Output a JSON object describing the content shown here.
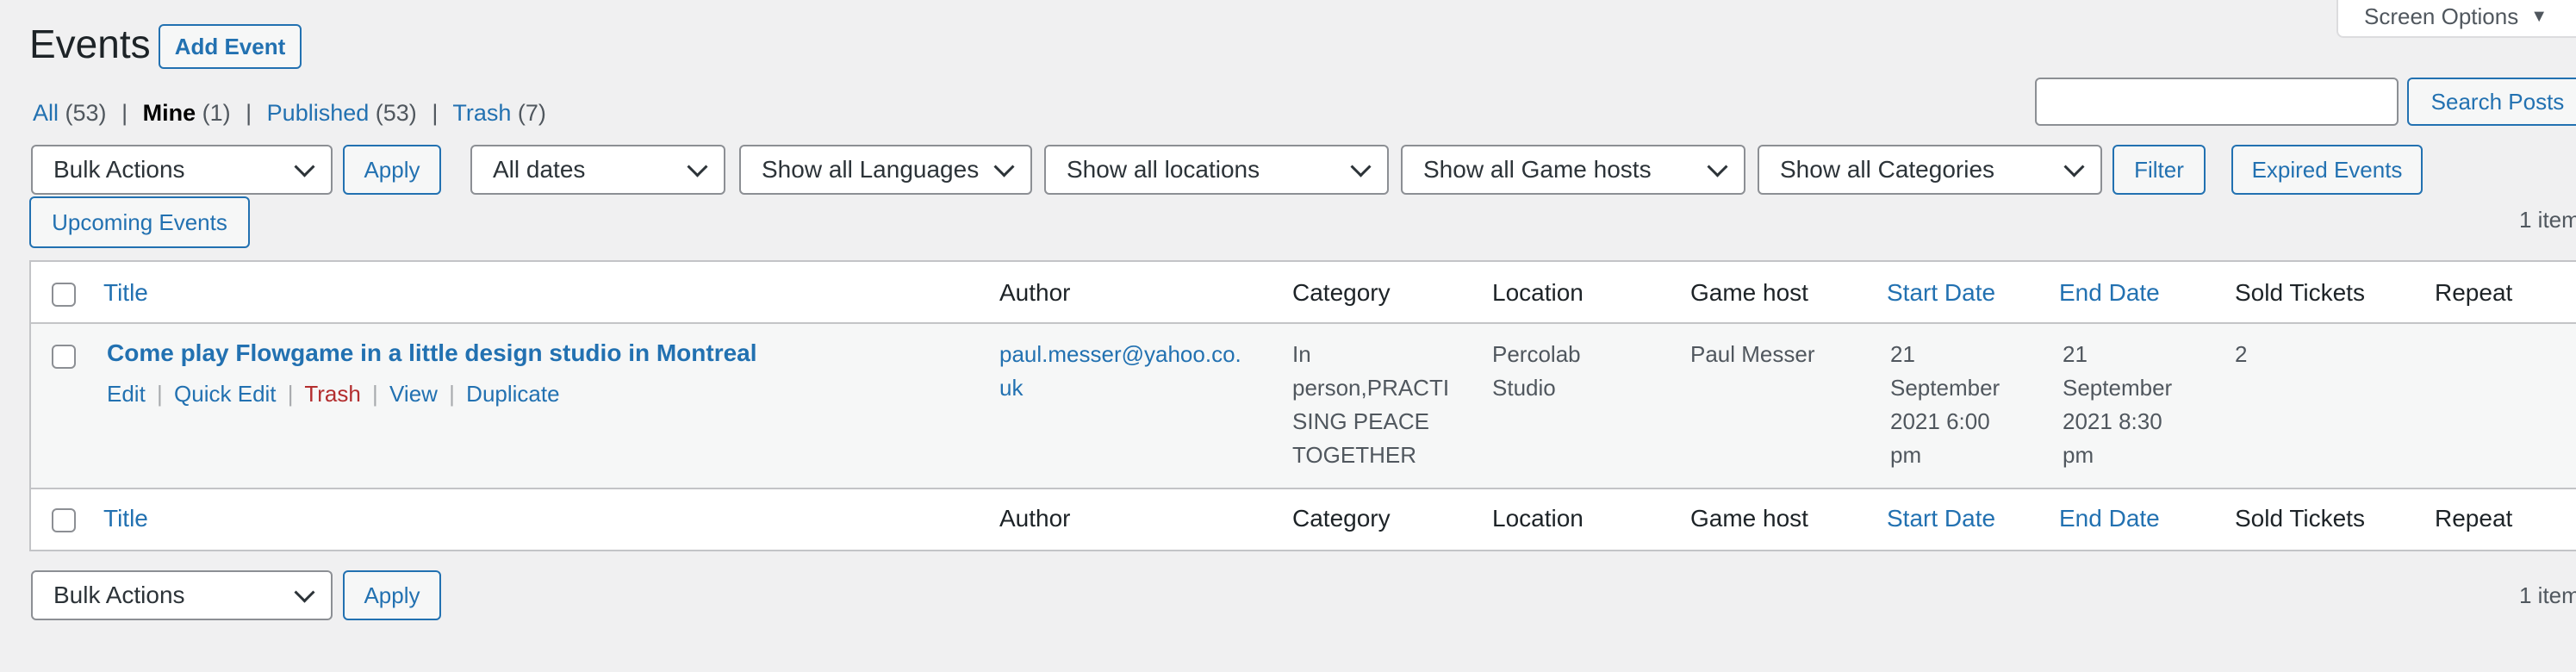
{
  "page": {
    "title": "Events",
    "add_button": "Add Event",
    "screen_options": "Screen Options"
  },
  "filters_nav": {
    "all_label": "All",
    "all_count": "(53)",
    "mine_label": "Mine",
    "mine_count": "(1)",
    "published_label": "Published",
    "published_count": "(53)",
    "trash_label": "Trash",
    "trash_count": "(7)",
    "sep": "|"
  },
  "search": {
    "button": "Search Posts",
    "value": ""
  },
  "toolbar": {
    "bulk_actions": "Bulk Actions",
    "apply": "Apply",
    "dates": "All dates",
    "languages": "Show all Languages",
    "locations": "Show all locations",
    "hosts": "Show all Game hosts",
    "categories": "Show all Categories",
    "filter": "Filter",
    "expired": "Expired Events",
    "upcoming": "Upcoming Events",
    "items_count": "1 item"
  },
  "table": {
    "columns": [
      "Title",
      "Author",
      "Category",
      "Location",
      "Game host",
      "Start Date",
      "End Date",
      "Sold Tickets",
      "Repeat"
    ],
    "rows": [
      {
        "title": "Come play Flowgame in a little design studio in Montreal",
        "actions": {
          "edit": "Edit",
          "quick_edit": "Quick Edit",
          "trash": "Trash",
          "view": "View",
          "duplicate": "Duplicate"
        },
        "author_line1": "paul.messer@yahoo.co.",
        "author_line2": "uk",
        "category_lines": [
          "In",
          "person,PRACTI",
          "SING PEACE",
          "TOGETHER"
        ],
        "location_lines": [
          "Percolab",
          "Studio"
        ],
        "game_host": "Paul Messer",
        "start_lines": [
          "21",
          "September",
          "2021 6:00",
          "pm"
        ],
        "end_lines": [
          "21",
          "September",
          "2021 8:30",
          "pm"
        ],
        "sold_tickets": "2",
        "repeat": ""
      }
    ]
  },
  "colors": {
    "link": "#2271b1",
    "trash": "#b32d2e",
    "background": "#f0f0f1"
  }
}
